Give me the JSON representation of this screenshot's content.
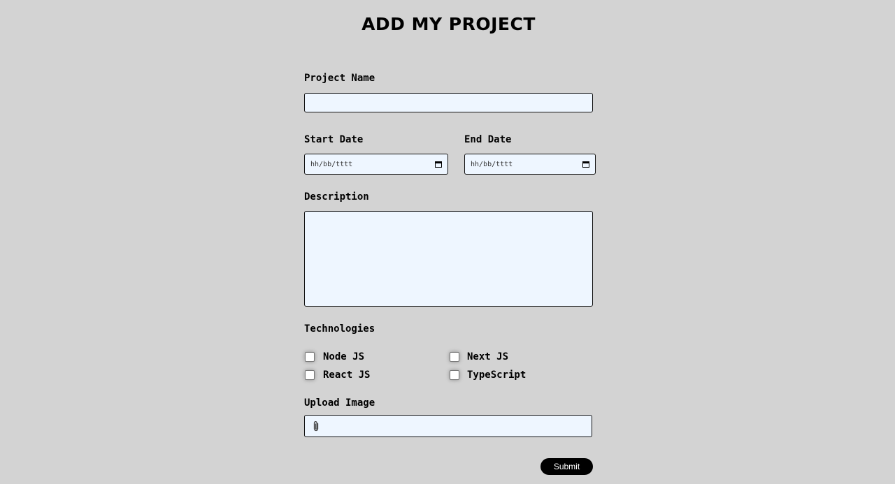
{
  "page": {
    "title": "ADD MY PROJECT"
  },
  "form": {
    "project_name": {
      "label": "Project Name",
      "value": ""
    },
    "start_date": {
      "label": "Start Date",
      "placeholder": "hh/bb/tttt"
    },
    "end_date": {
      "label": "End Date",
      "placeholder": "hh/bb/tttt"
    },
    "description": {
      "label": "Description",
      "value": ""
    },
    "technologies": {
      "label": "Technologies",
      "options": [
        {
          "label": "Node JS",
          "checked": false
        },
        {
          "label": "Next JS",
          "checked": false
        },
        {
          "label": "React JS",
          "checked": false
        },
        {
          "label": "TypeScript",
          "checked": false
        }
      ]
    },
    "upload": {
      "label": "Upload Image",
      "icon": "paperclip-icon"
    },
    "submit_label": "Submit"
  },
  "colors": {
    "background": "#d3d3d3",
    "input_background": "#eef6ff",
    "button_background": "#000000",
    "button_text": "#ffffff"
  }
}
